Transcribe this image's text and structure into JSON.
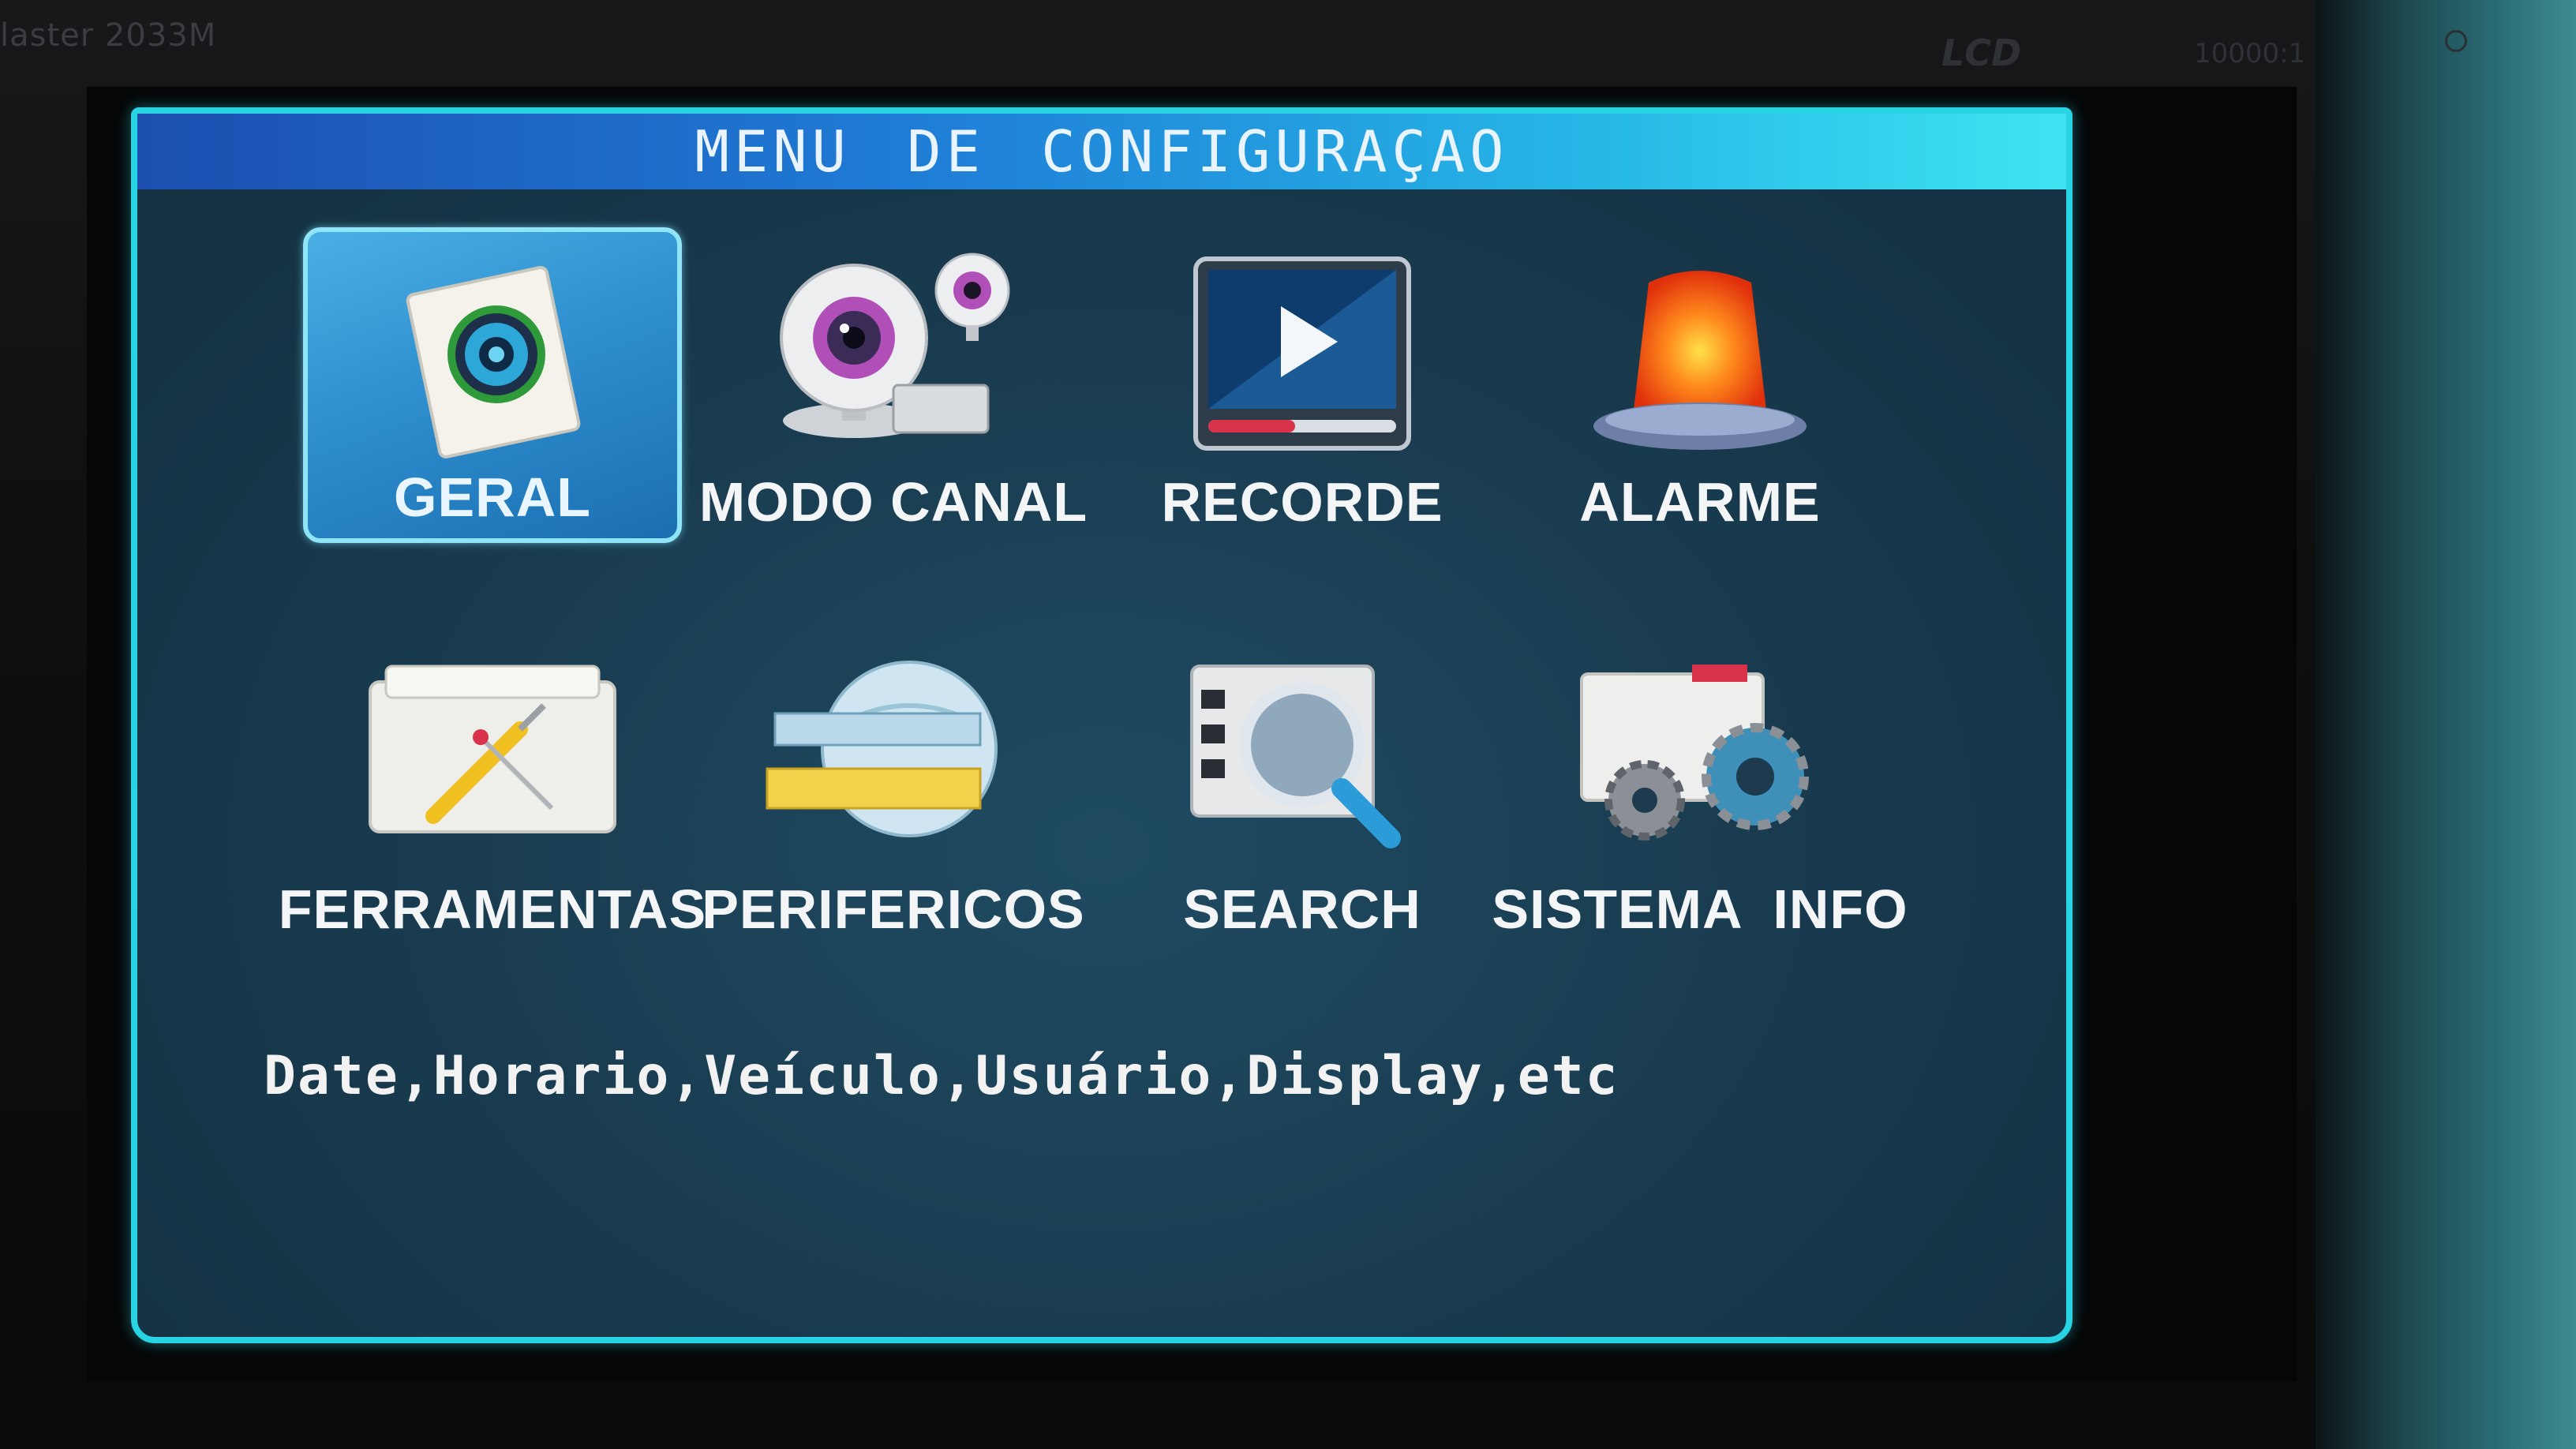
{
  "bezel": {
    "brand": "laster 2033M",
    "lcd_logo": "LCD",
    "ratio": "10000:1"
  },
  "menu": {
    "title": "MENU DE CONFIGURAÇAO",
    "items": [
      {
        "label": "GERAL",
        "icon": "settings-document-icon",
        "selected": true
      },
      {
        "label": "MODO CANAL",
        "icon": "webcam-icon",
        "selected": false
      },
      {
        "label": "RECORDE",
        "icon": "video-play-icon",
        "selected": false
      },
      {
        "label": "ALARME",
        "icon": "alarm-beacon-icon",
        "selected": false
      },
      {
        "label": "FERRAMENTAS",
        "icon": "toolbox-icon",
        "selected": false
      },
      {
        "label": "PERIFERICOS",
        "icon": "globe-peripherals-icon",
        "selected": false
      },
      {
        "label": "SEARCH",
        "icon": "magnifier-film-icon",
        "selected": false
      },
      {
        "label": "SISTEMA  INFO",
        "icon": "system-gears-icon",
        "selected": false
      }
    ],
    "description": "Date,Horario,Veículo,Usuário,Display,etc"
  },
  "colors": {
    "panel_border": "#28d4e4",
    "panel_bg": "#193b4f",
    "selected_bg": "#2f8fcf",
    "title_bar": "#1f7cd6"
  }
}
